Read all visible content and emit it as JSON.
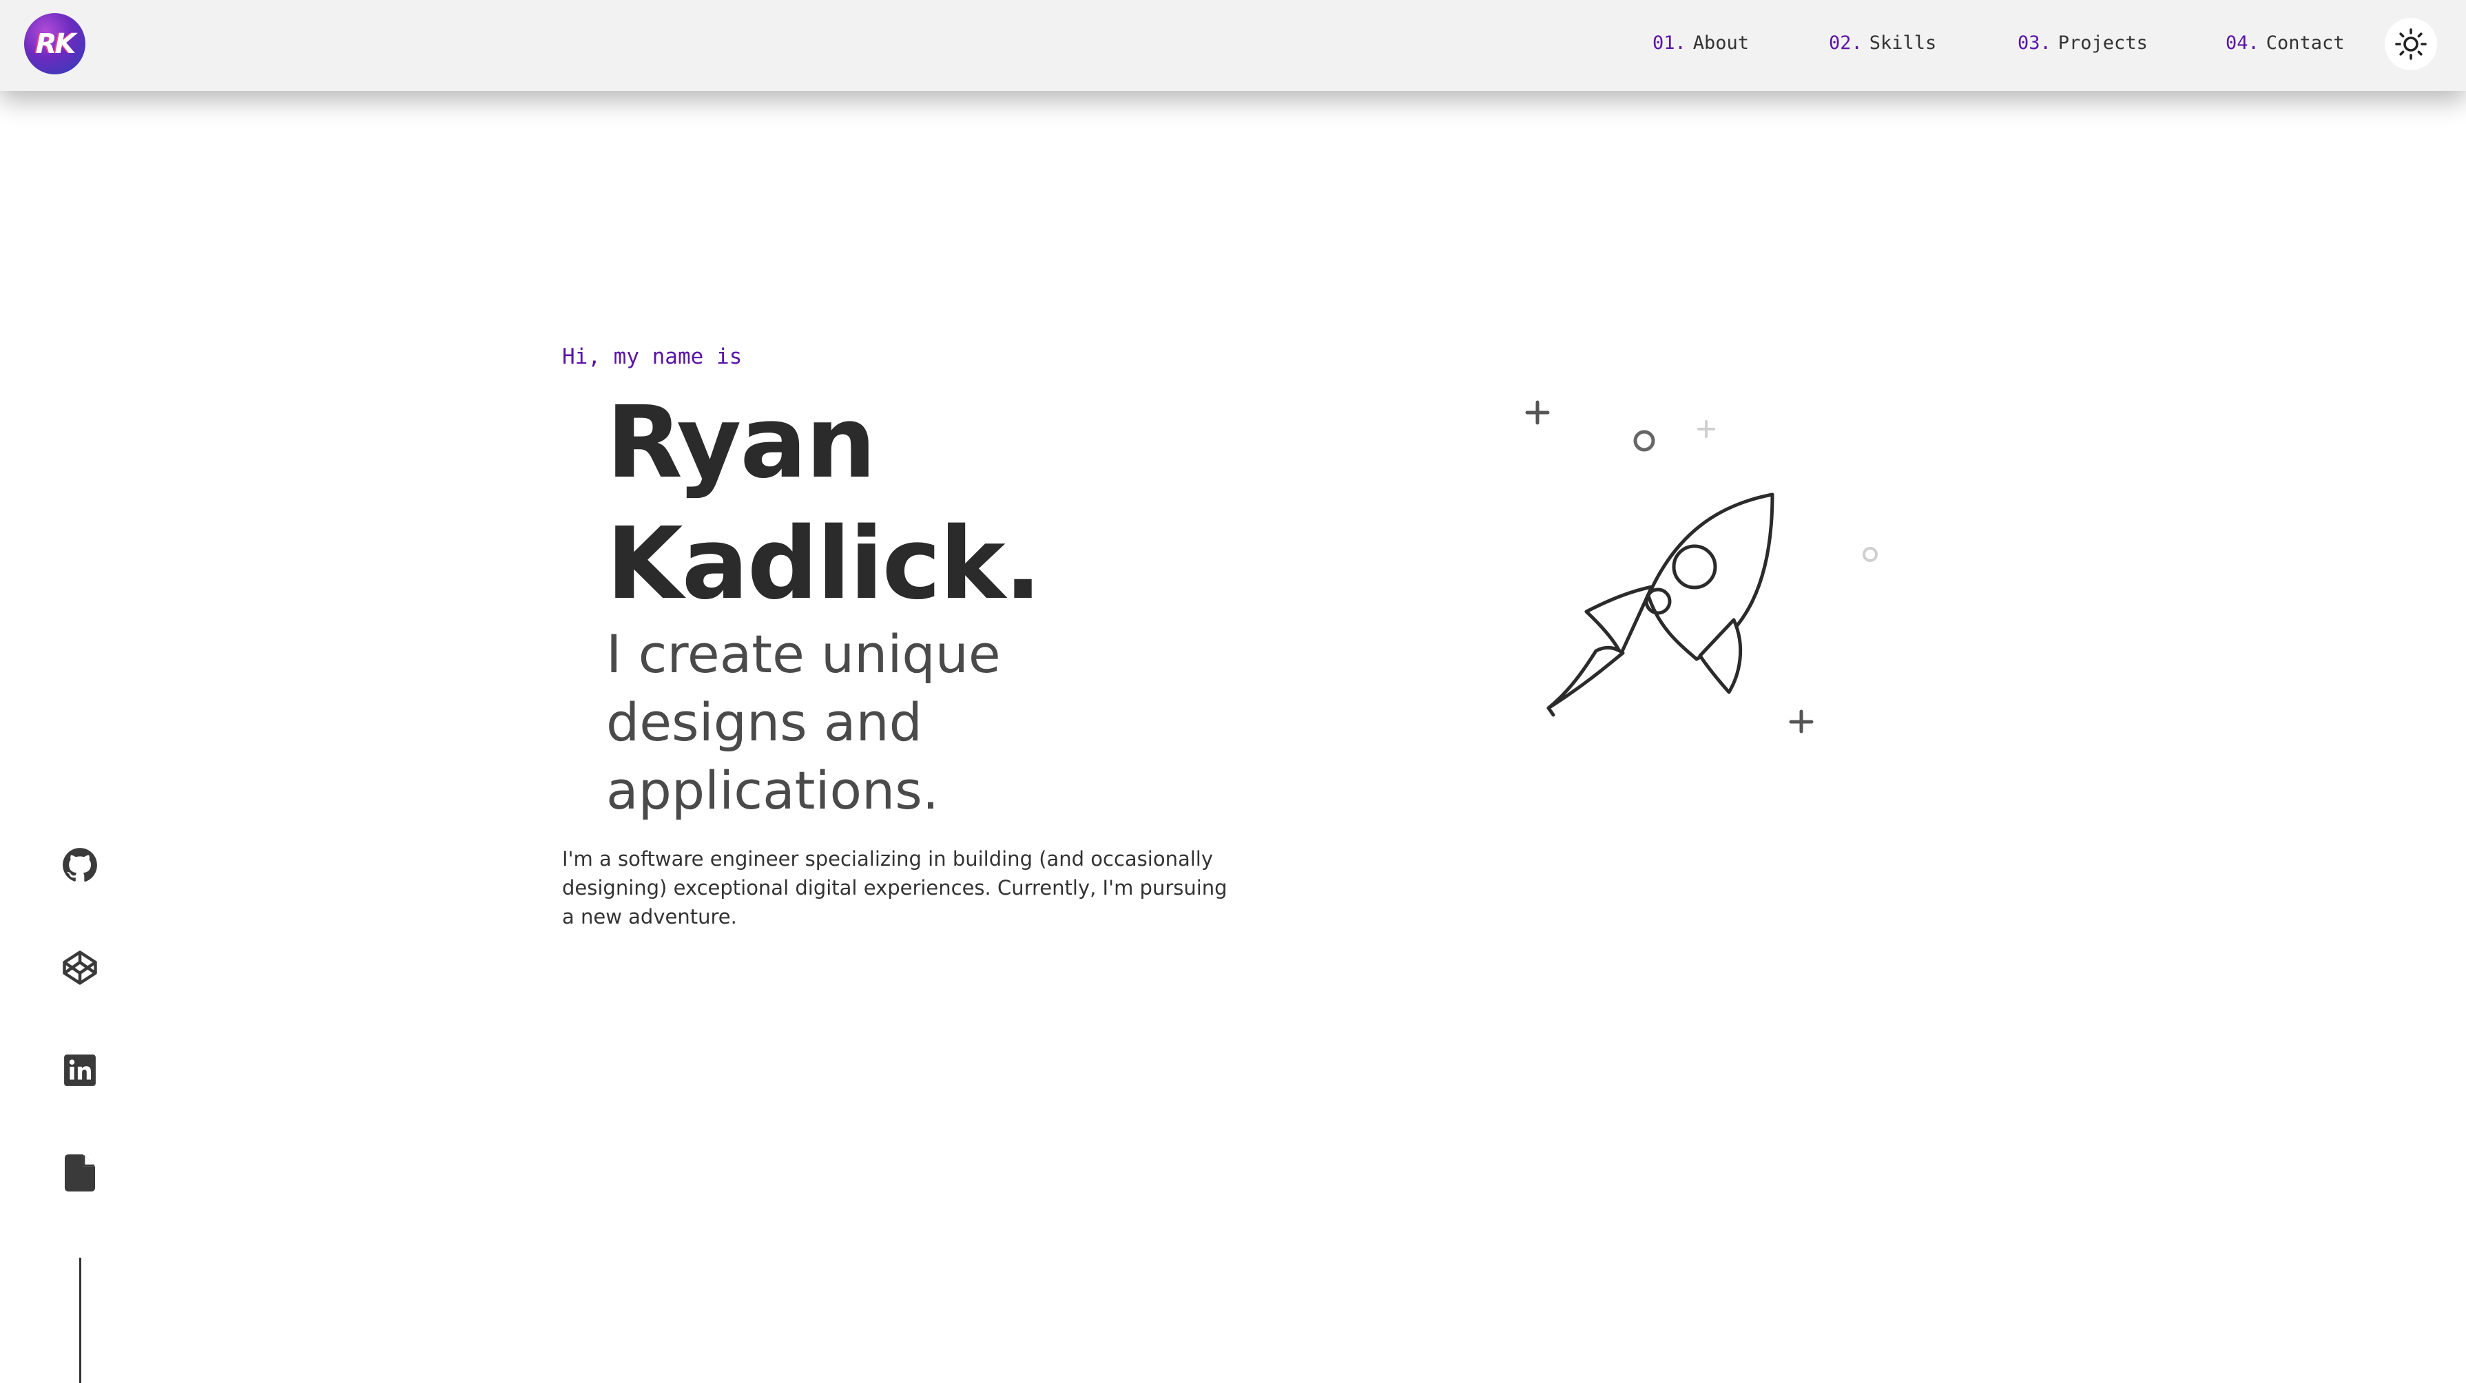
{
  "header": {
    "logo_text": "RK",
    "nav": [
      {
        "num": "01.",
        "label": "About"
      },
      {
        "num": "02.",
        "label": "Skills"
      },
      {
        "num": "03.",
        "label": "Projects"
      },
      {
        "num": "04.",
        "label": "Contact"
      }
    ],
    "theme_toggle_icon": "sun-icon"
  },
  "hero": {
    "greeting": "Hi, my name is",
    "name_line1": "Ryan",
    "name_line2": "Kadlick.",
    "tagline_line1": "I create unique",
    "tagline_line2": "designs and",
    "tagline_line3": "applications.",
    "bio": "I'm a software engineer specializing in building (and occasionally designing) exceptional digital experiences. Currently, I'm pursuing a new adventure.",
    "illustration_icon": "rocket-icon"
  },
  "social": {
    "items": [
      "github-icon",
      "codepen-icon",
      "linkedin-icon",
      "resume-file-icon"
    ]
  },
  "colors": {
    "accent": "#5a14a6",
    "text_dark": "#2b2b2b",
    "header_bg": "#f2f2f2"
  }
}
